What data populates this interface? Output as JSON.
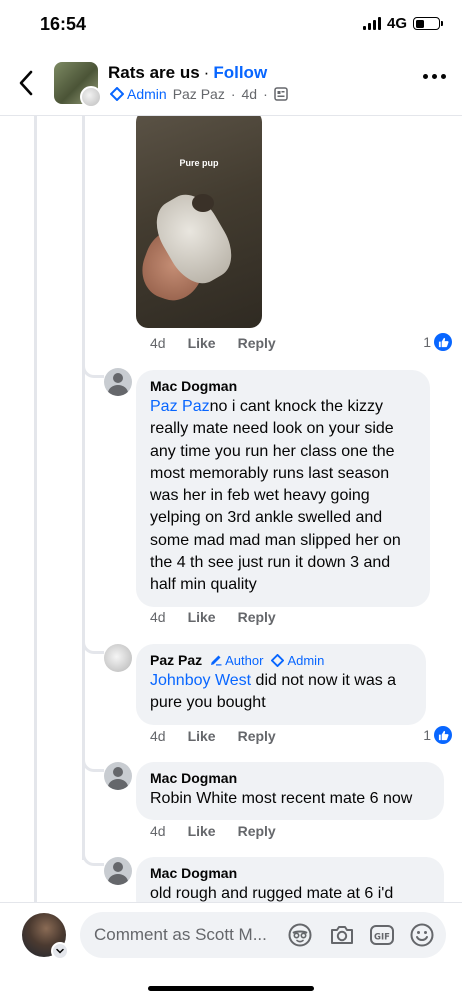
{
  "status_bar": {
    "time": "16:54",
    "network": "4G"
  },
  "header": {
    "group_name": "Rats are us",
    "separator": "·",
    "follow_label": "Follow",
    "admin_label": "Admin",
    "poster": "Paz Paz",
    "time": "4d",
    "dot": "·"
  },
  "media": {
    "caption": "Pure pup"
  },
  "comments": [
    {
      "time": "4d",
      "like_label": "Like",
      "reply_label": "Reply",
      "reaction_count": "1"
    },
    {
      "author": "Mac Dogman",
      "mention": "Paz Paz",
      "text": "no i cant knock the kizzy really mate need look on your side any time you run her class one the most memorably runs last season was her in feb wet heavy going yelping on 3rd ankle swelled and some mad mad man slipped her on the 4 th see just run it down 3 and half min quality",
      "time": "4d",
      "like_label": "Like",
      "reply_label": "Reply"
    },
    {
      "author": "Paz Paz",
      "author_tag": "Author",
      "admin_tag": "Admin",
      "mention": "Johnboy West",
      "text": " did not now it was a pure you bought",
      "time": "4d",
      "like_label": "Like",
      "reply_label": "Reply",
      "reaction_count": "1"
    },
    {
      "author": "Mac Dogman",
      "text": "Robin White most recent mate 6 now",
      "time": "4d",
      "like_label": "Like",
      "reply_label": "Reply"
    },
    {
      "author": "Mac Dogman",
      "text": "old rough and rugged mate at 6 i'd"
    }
  ],
  "composer": {
    "placeholder": "Comment as Scott M..."
  },
  "colors": {
    "accent": "#0866ff",
    "bubble": "#f0f2f5",
    "muted": "#65676b"
  }
}
